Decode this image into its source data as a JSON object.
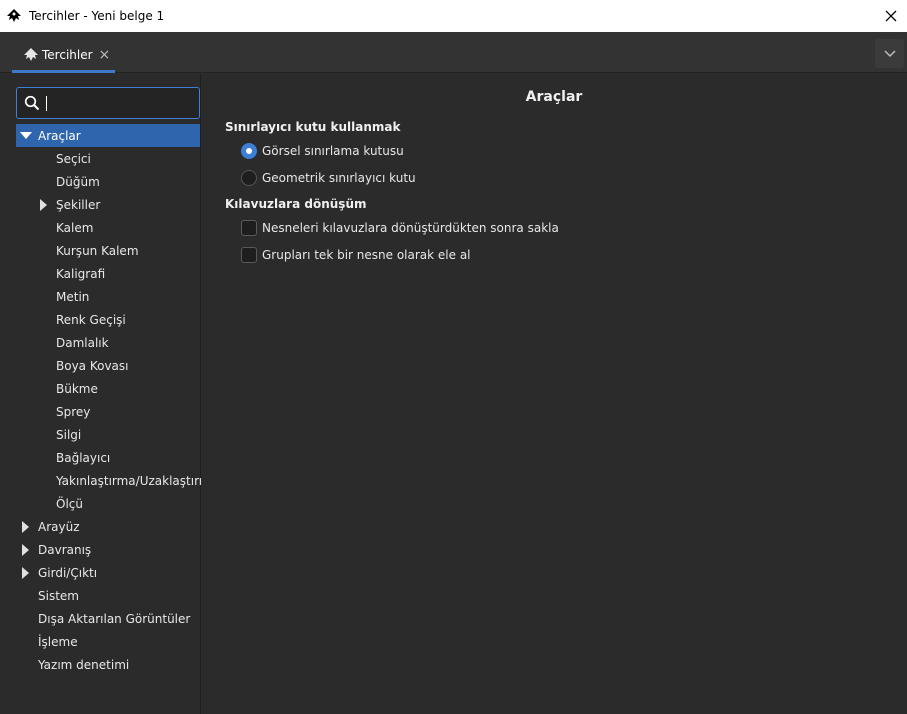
{
  "window": {
    "title": "Tercihler - Yeni belge 1"
  },
  "tab": {
    "label": "Tercihler",
    "close_glyph": "×"
  },
  "search": {
    "value": "",
    "placeholder": ""
  },
  "tree": {
    "root": "Araçlar",
    "children": [
      "Seçici",
      "Düğüm",
      "Şekiller",
      "Kalem",
      "Kurşun Kalem",
      "Kaligrafi",
      "Metin",
      "Renk Geçişi",
      "Damlalık",
      "Boya Kovası",
      "Bükme",
      "Sprey",
      "Silgi",
      "Bağlayıcı",
      "Yakınlaştırma/Uzaklaştırma",
      "Ölçü"
    ],
    "top_level": [
      "Arayüz",
      "Davranış",
      "Girdi/Çıktı",
      "Sistem",
      "Dışa Aktarılan Görüntüler",
      "İşleme",
      "Yazım denetimi"
    ]
  },
  "page": {
    "title": "Araçlar",
    "bbox_section": "Sınırlayıcı kutu kullanmak",
    "bbox_options": [
      "Görsel sınırlama kutusu",
      "Geometrik sınırlayıcı kutu"
    ],
    "guides_section": "Kılavuzlara dönüşüm",
    "guides_options": [
      "Nesneleri kılavuzlara dönüştürdükten sonra sakla",
      "Grupları tek bir nesne olarak ele al"
    ]
  },
  "colors": {
    "accent": "#3d7fd6",
    "selection": "#2f65ad",
    "background": "#2b2b2b"
  },
  "icons": {
    "app": "inkscape-icon",
    "search": "search-icon",
    "menu": "chevron-down-icon"
  }
}
